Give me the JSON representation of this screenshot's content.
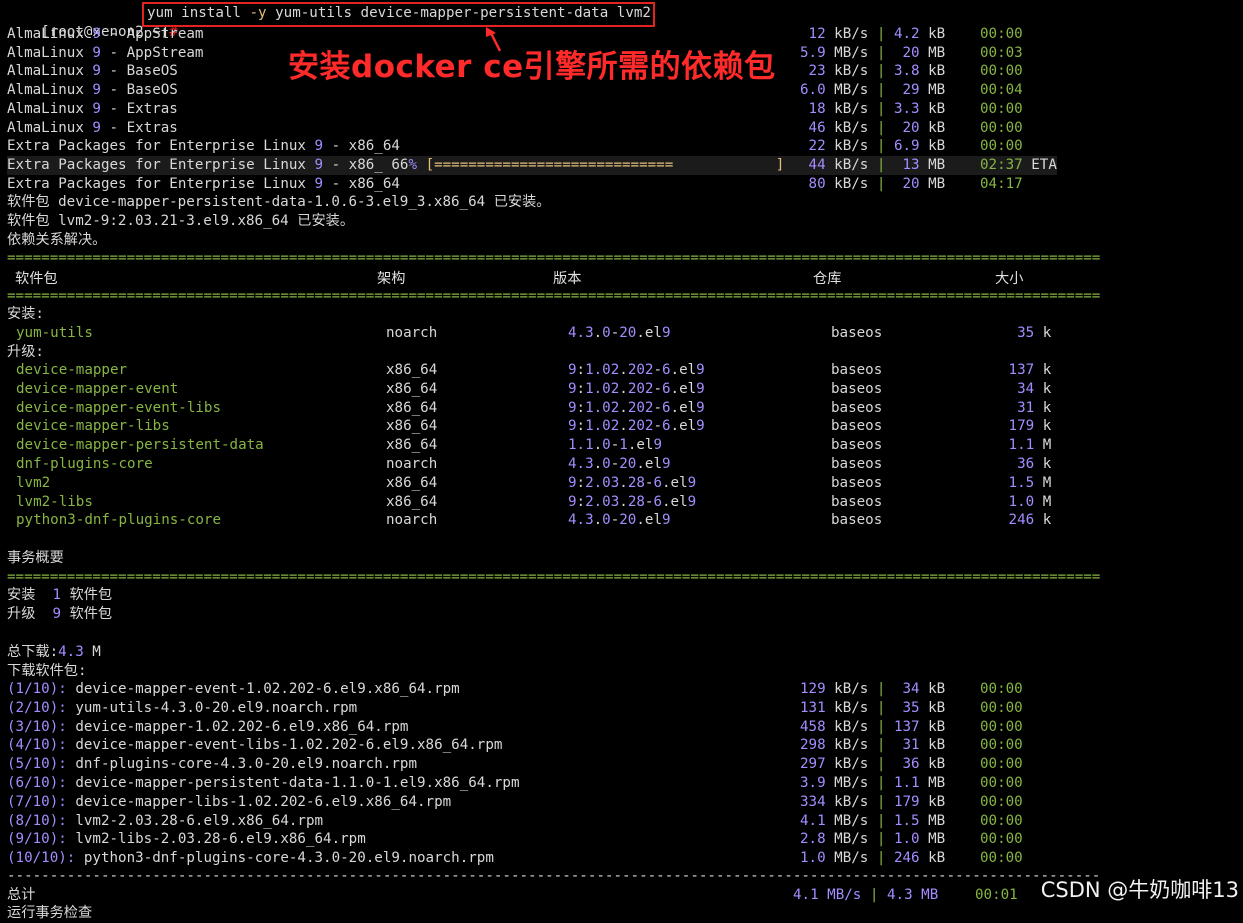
{
  "prompt": {
    "user_host": "[root@xenon2 ~]",
    "hash": "#",
    "command": "yum install -y yum-utils device-mapper-persistent-data lvm2"
  },
  "annotation": "安装docker ce引擎所需的依赖包",
  "repos": [
    {
      "name": "AlmaLinux 9 - AppStream",
      "speed": "12 kB/s",
      "size": "4.2 kB",
      "time": "00:00"
    },
    {
      "name": "AlmaLinux 9 - AppStream",
      "speed": "5.9 MB/s",
      "size": "20 MB",
      "time": "00:03"
    },
    {
      "name": "AlmaLinux 9 - BaseOS",
      "speed": "23 kB/s",
      "size": "3.8 kB",
      "time": "00:00"
    },
    {
      "name": "AlmaLinux 9 - BaseOS",
      "speed": "6.0 MB/s",
      "size": "29 MB",
      "time": "00:04"
    },
    {
      "name": "AlmaLinux 9 - Extras",
      "speed": "18 kB/s",
      "size": "3.3 kB",
      "time": "00:00"
    },
    {
      "name": "AlmaLinux 9 - Extras",
      "speed": "46 kB/s",
      "size": "20 kB",
      "time": "00:00"
    },
    {
      "name": "Extra Packages for Enterprise Linux 9 - x86_64",
      "speed": "22 kB/s",
      "size": "6.9 kB",
      "time": "00:00"
    },
    {
      "name": "Extra Packages for Enterprise Linux 9 - x86_ 66% [============================            ]",
      "speed": "44 kB/s",
      "size": "13 MB",
      "time": "02:37 ETA"
    },
    {
      "name": "Extra Packages for Enterprise Linux 9 - x86_64",
      "speed": "80 kB/s",
      "size": "20 MB",
      "time": "04:17"
    }
  ],
  "notes": [
    "软件包 device-mapper-persistent-data-1.0.6-3.el9_3.x86_64 已安装。",
    "软件包 lvm2-9:2.03.21-3.el9.x86_64 已安装。",
    "依赖关系解决。"
  ],
  "separator": "================================================================================================================================",
  "dash_separator": "--------------------------------------------------------------------------------------------------------------------------------",
  "table_headers": {
    "package": "软件包",
    "arch": "架构",
    "version": "版本",
    "repo": "仓库",
    "size": "大小"
  },
  "install_label": "安装:",
  "upgrade_label": "升级:",
  "install_pkgs": [
    {
      "name": "yum-utils",
      "arch": "noarch",
      "version": "4.3.0-20.el9",
      "repo": "baseos",
      "size": "35 k"
    }
  ],
  "upgrade_pkgs": [
    {
      "name": "device-mapper",
      "arch": "x86_64",
      "version": "9:1.02.202-6.el9",
      "repo": "baseos",
      "size": "137 k"
    },
    {
      "name": "device-mapper-event",
      "arch": "x86_64",
      "version": "9:1.02.202-6.el9",
      "repo": "baseos",
      "size": "34 k"
    },
    {
      "name": "device-mapper-event-libs",
      "arch": "x86_64",
      "version": "9:1.02.202-6.el9",
      "repo": "baseos",
      "size": "31 k"
    },
    {
      "name": "device-mapper-libs",
      "arch": "x86_64",
      "version": "9:1.02.202-6.el9",
      "repo": "baseos",
      "size": "179 k"
    },
    {
      "name": "device-mapper-persistent-data",
      "arch": "x86_64",
      "version": "1.1.0-1.el9",
      "repo": "baseos",
      "size": "1.1 M"
    },
    {
      "name": "dnf-plugins-core",
      "arch": "noarch",
      "version": "4.3.0-20.el9",
      "repo": "baseos",
      "size": "36 k"
    },
    {
      "name": "lvm2",
      "arch": "x86_64",
      "version": "9:2.03.28-6.el9",
      "repo": "baseos",
      "size": "1.5 M"
    },
    {
      "name": "lvm2-libs",
      "arch": "x86_64",
      "version": "9:2.03.28-6.el9",
      "repo": "baseos",
      "size": "1.0 M"
    },
    {
      "name": "python3-dnf-plugins-core",
      "arch": "noarch",
      "version": "4.3.0-20.el9",
      "repo": "baseos",
      "size": "246 k"
    }
  ],
  "summary_title": "事务概要",
  "summary_install": "安装  1 软件包",
  "summary_upgrade": "升级  9 软件包",
  "total_download": "总下载:4.3 M",
  "downloading": "下载软件包:",
  "downloads": [
    {
      "idx": "(1/10):",
      "file": "device-mapper-event-1.02.202-6.el9.x86_64.rpm",
      "speed": "129 kB/s",
      "size": "34 kB",
      "time": "00:00"
    },
    {
      "idx": "(2/10):",
      "file": "yum-utils-4.3.0-20.el9.noarch.rpm",
      "speed": "131 kB/s",
      "size": "35 kB",
      "time": "00:00"
    },
    {
      "idx": "(3/10):",
      "file": "device-mapper-1.02.202-6.el9.x86_64.rpm",
      "speed": "458 kB/s",
      "size": "137 kB",
      "time": "00:00"
    },
    {
      "idx": "(4/10):",
      "file": "device-mapper-event-libs-1.02.202-6.el9.x86_64.rpm",
      "speed": "298 kB/s",
      "size": "31 kB",
      "time": "00:00"
    },
    {
      "idx": "(5/10):",
      "file": "dnf-plugins-core-4.3.0-20.el9.noarch.rpm",
      "speed": "297 kB/s",
      "size": "36 kB",
      "time": "00:00"
    },
    {
      "idx": "(6/10):",
      "file": "device-mapper-persistent-data-1.1.0-1.el9.x86_64.rpm",
      "speed": "3.9 MB/s",
      "size": "1.1 MB",
      "time": "00:00"
    },
    {
      "idx": "(7/10):",
      "file": "device-mapper-libs-1.02.202-6.el9.x86_64.rpm",
      "speed": "334 kB/s",
      "size": "179 kB",
      "time": "00:00"
    },
    {
      "idx": "(8/10):",
      "file": "lvm2-2.03.28-6.el9.x86_64.rpm",
      "speed": "4.1 MB/s",
      "size": "1.5 MB",
      "time": "00:00"
    },
    {
      "idx": "(9/10):",
      "file": "lvm2-libs-2.03.28-6.el9.x86_64.rpm",
      "speed": "2.8 MB/s",
      "size": "1.0 MB",
      "time": "00:00"
    },
    {
      "idx": "(10/10):",
      "file": "python3-dnf-plugins-core-4.3.0-20.el9.noarch.rpm",
      "speed": "1.0 MB/s",
      "size": "246 kB",
      "time": "00:00"
    }
  ],
  "total": {
    "label": "总计",
    "speed": "4.1 MB/s",
    "size": "4.3 MB",
    "time": "00:01"
  },
  "partial_last_line": "运行事务检查",
  "watermark": "CSDN @牛奶咖啡13",
  "colors": {
    "background": "#000000",
    "text": "#d8d8d8",
    "number": "#a58cff",
    "package": "#86b542",
    "annotation": "#ff2a2a",
    "box": "#e32222"
  }
}
